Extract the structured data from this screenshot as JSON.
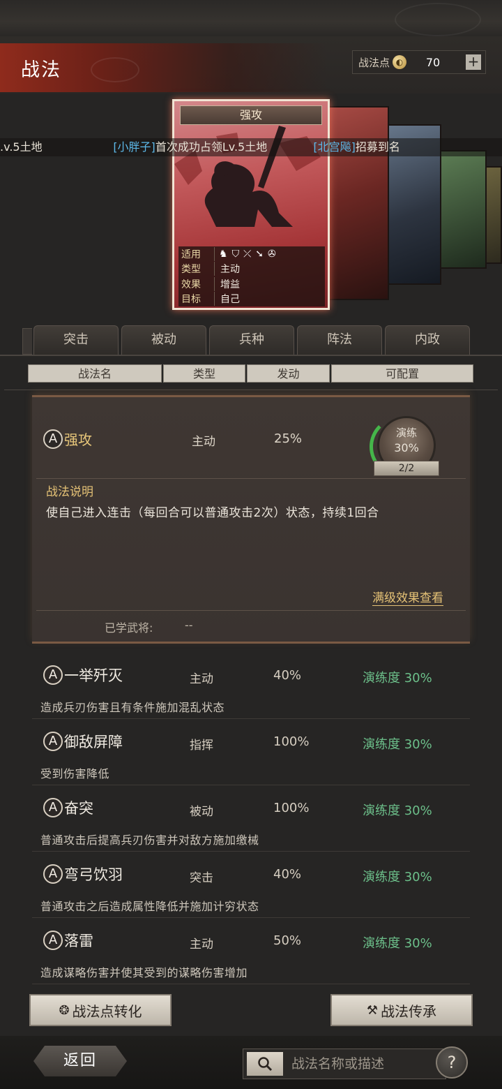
{
  "header": {
    "title": "战法",
    "points_label": "战法点",
    "points_value": "70",
    "plus_label": "+"
  },
  "ticker": {
    "part1": ".v.5土地",
    "name1": "[小胖子]",
    "part2": "首次成功占领Lv.5土地",
    "name2": "[北宫飚]",
    "part3": "招募到名"
  },
  "card": {
    "title": "强攻",
    "rows": [
      {
        "key": "适用",
        "value": ""
      },
      {
        "key": "类型",
        "value": "主动"
      },
      {
        "key": "效果",
        "value": "增益"
      },
      {
        "key": "目标",
        "value": "自己"
      }
    ]
  },
  "tabs": [
    "突击",
    "被动",
    "兵种",
    "阵法",
    "内政"
  ],
  "columns": [
    "战法名",
    "类型",
    "发动",
    "可配置"
  ],
  "selected": {
    "grade": "A",
    "name": "强攻",
    "type": "主动",
    "rate": "25%",
    "train_label": "演练",
    "train_pct": "30%",
    "train_count": "2/2",
    "desc_title": "战法说明",
    "desc_text": "使自己进入连击（每回合可以普通攻击2次）状态，持续1回合",
    "full_link": "满级效果查看",
    "learned_label": "已学武将:",
    "learned_value": "--"
  },
  "skills": [
    {
      "grade": "A",
      "name": "一举歼灭",
      "type": "主动",
      "rate": "40%",
      "train": "演练度 30%",
      "desc": "造成兵刃伤害且有条件施加混乱状态"
    },
    {
      "grade": "A",
      "name": "御敌屏障",
      "type": "指挥",
      "rate": "100%",
      "train": "演练度 30%",
      "desc": "受到伤害降低"
    },
    {
      "grade": "A",
      "name": "奋突",
      "type": "被动",
      "rate": "100%",
      "train": "演练度 30%",
      "desc": "普通攻击后提高兵刃伤害并对敌方施加缴械"
    },
    {
      "grade": "A",
      "name": "弯弓饮羽",
      "type": "突击",
      "rate": "40%",
      "train": "演练度 30%",
      "desc": "普通攻击之后造成属性降低并施加计穷状态"
    },
    {
      "grade": "A",
      "name": "落雷",
      "type": "主动",
      "rate": "50%",
      "train": "演练度 30%",
      "desc": "造成谋略伤害并使其受到的谋略伤害增加"
    }
  ],
  "buttons": {
    "convert": "战法点转化",
    "inherit": "战法传承",
    "back": "返回",
    "help": "?"
  },
  "search": {
    "placeholder": "战法名称或描述"
  },
  "colors": {
    "accent_gold": "#e5c276",
    "train_green": "#6cbf8a",
    "ticker_name": "#5cb8e8"
  }
}
